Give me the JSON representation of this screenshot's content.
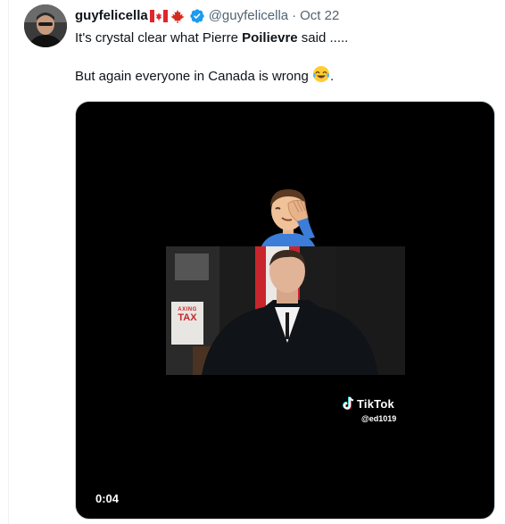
{
  "tweet": {
    "display_name": "guyfelicella",
    "handle": "@guyfelicella",
    "separator": "·",
    "date": "Oct 22",
    "text": {
      "line1_before": "It's crystal clear what Pierre ",
      "line1_bold": "Poilievre",
      "line1_after": " said .....",
      "line2": "But again everyone in Canada is wrong ",
      "line2_after": "."
    },
    "icons": {
      "flag": "canada-flag-icon",
      "maple": "maple-leaf-icon",
      "verified": "verified-badge-icon",
      "emoji": "face-with-tears-of-joy-icon"
    },
    "colors": {
      "verified_blue": "#1d9bf0",
      "secondary_text": "#536471"
    }
  },
  "media": {
    "overlay_emoji": "man-facepalming-icon",
    "book_title_top": "AXING",
    "book_title_main": "TAX",
    "watermark_brand": "TikTok",
    "watermark_user": "@ed1019",
    "timestamp": "0:04"
  }
}
